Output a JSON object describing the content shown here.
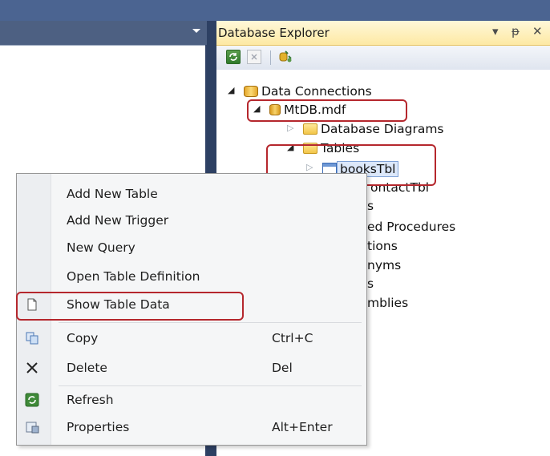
{
  "document_tab": {
    "dropdown_icon": "chevron-down-icon"
  },
  "explorer": {
    "title": "Database Explorer",
    "controls": {
      "dropdown": "▾",
      "pin": "ᵽ",
      "close": "✕"
    },
    "toolbar": [
      "refresh-icon",
      "stop-icon",
      "connect-icon"
    ],
    "tree": [
      {
        "label": "Data Connections",
        "icon": "data-connections-icon",
        "expanded": true
      },
      {
        "label": "MtDB.mdf",
        "icon": "database-icon",
        "expanded": true
      },
      {
        "label": "Database Diagrams",
        "icon": "folder-icon",
        "expanded": false
      },
      {
        "label": "Tables",
        "icon": "folder-icon",
        "expanded": true
      },
      {
        "label": "booksTbl",
        "icon": "table-icon",
        "expanded": false,
        "selected": true
      },
      {
        "label": "ontactTbl"
      },
      {
        "label": "s"
      },
      {
        "label": "ed Procedures"
      },
      {
        "label": "tions"
      },
      {
        "label": "nyms"
      },
      {
        "label": "s"
      },
      {
        "label": "mblies"
      }
    ]
  },
  "context_menu": {
    "items": [
      {
        "label": "Add New Table",
        "shortcut": ""
      },
      {
        "label": "Add New Trigger",
        "shortcut": ""
      },
      {
        "label": "New Query",
        "shortcut": ""
      },
      {
        "label": "Open Table Definition",
        "shortcut": ""
      },
      {
        "label": "Show Table Data",
        "shortcut": "",
        "icon": "document-icon"
      },
      {
        "label": "Copy",
        "shortcut": "Ctrl+C",
        "icon": "copy-icon"
      },
      {
        "label": "Delete",
        "shortcut": "Del",
        "icon": "delete-icon"
      },
      {
        "label": "Refresh",
        "shortcut": "",
        "icon": "refresh-icon"
      },
      {
        "label": "Properties",
        "shortcut": "Alt+Enter",
        "icon": "properties-icon"
      }
    ]
  },
  "colors": {
    "highlight_box": "#b5272d",
    "selection": "#dce8fa"
  }
}
